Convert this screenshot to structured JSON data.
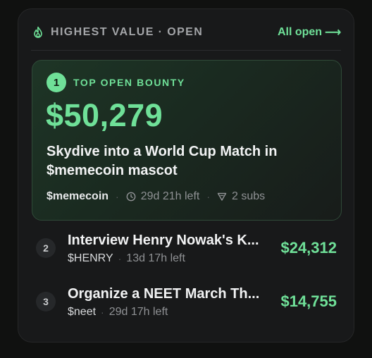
{
  "header": {
    "title": "HIGHEST VALUE · OPEN",
    "all_open_label": "All open",
    "all_open_arrow": "⟶"
  },
  "top_bounty": {
    "rank": "1",
    "label": "TOP OPEN BOUNTY",
    "amount": "$50,279",
    "title": "Skydive into a World Cup Match in $memecoin mascot",
    "ticker": "$memecoin",
    "time_left": "29d 21h left",
    "subs": "2 subs"
  },
  "bounties": [
    {
      "rank": "2",
      "title": "Interview Henry Nowak's K...",
      "ticker": "$HENRY",
      "time_left": "13d 17h left",
      "amount": "$24,312"
    },
    {
      "rank": "3",
      "title": "Organize a NEET March Th...",
      "ticker": "$neet",
      "time_left": "29d 17h left",
      "amount": "$14,755"
    }
  ],
  "colors": {
    "accent": "#6fe098",
    "card_bg": "#18191a",
    "page_bg": "#101110"
  },
  "separator": "·",
  "icons": {
    "header": "flame-icon",
    "time": "clock-icon",
    "subs": "filter-icon"
  }
}
